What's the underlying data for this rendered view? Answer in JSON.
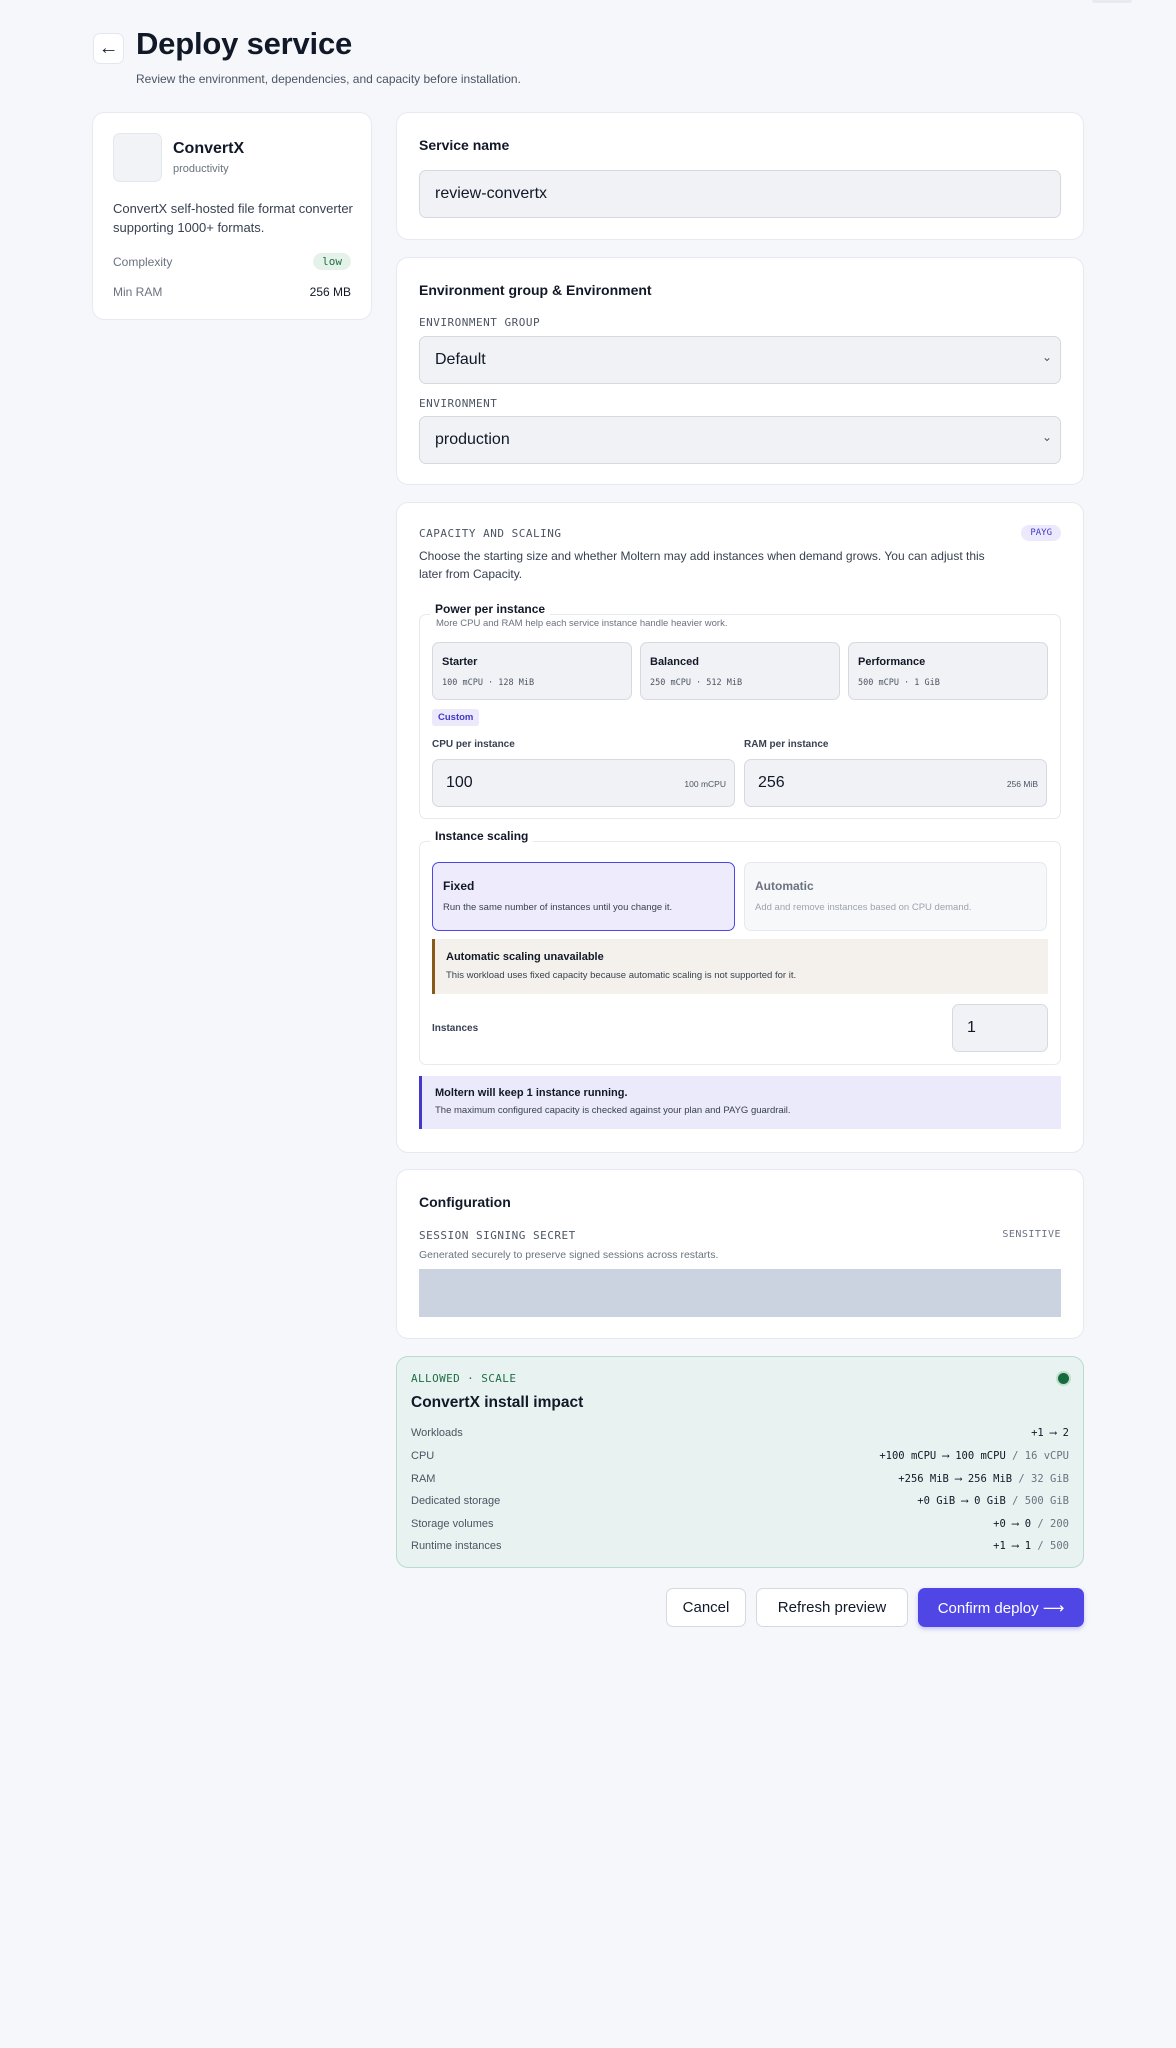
{
  "header": {
    "back_icon": "←",
    "title": "Deploy service",
    "subtitle": "Review the environment, dependencies, and capacity before installation."
  },
  "app": {
    "name": "ConvertX",
    "category": "productivity",
    "description": "ConvertX self-hosted file format converter supporting 1000+ formats.",
    "complexity_label": "Complexity",
    "complexity_value": "low",
    "min_ram_label": "Min RAM",
    "min_ram_value": "256 MB"
  },
  "service_name": {
    "title": "Service name",
    "value": "review-convertx"
  },
  "environment": {
    "title": "Environment group & Environment",
    "group_label": "ENVIRONMENT GROUP",
    "group_value": "Default",
    "env_label": "ENVIRONMENT",
    "env_value": "production",
    "chevron": "⌄"
  },
  "capacity": {
    "label": "CAPACITY AND SCALING",
    "badge": "PAYG",
    "description": "Choose the starting size and whether Moltern may add instances when demand grows. You can adjust this later from Capacity.",
    "power": {
      "legend": "Power per instance",
      "subtitle": "More CPU and RAM help each service instance handle heavier work.",
      "tiers": [
        {
          "name": "Starter",
          "spec": "100 mCPU · 128 MiB"
        },
        {
          "name": "Balanced",
          "spec": "250 mCPU · 512 MiB"
        },
        {
          "name": "Performance",
          "spec": "500 mCPU · 1 GiB"
        }
      ],
      "custom_tag": "Custom",
      "cpu_label": "CPU per instance",
      "cpu_value": "100",
      "cpu_unit": "100 mCPU",
      "ram_label": "RAM per instance",
      "ram_value": "256",
      "ram_unit": "256 MiB"
    },
    "scaling": {
      "legend": "Instance scaling",
      "fixed_title": "Fixed",
      "fixed_desc": "Run the same number of instances until you change it.",
      "auto_title": "Automatic",
      "auto_desc": "Add and remove instances based on CPU demand.",
      "warn_title": "Automatic scaling unavailable",
      "warn_desc": "This workload uses fixed capacity because automatic scaling is not supported for it.",
      "instances_label": "Instances",
      "instances_value": "1"
    },
    "info_title": "Moltern will keep 1 instance running.",
    "info_desc": "The maximum configured capacity is checked against your plan and PAYG guardrail."
  },
  "configuration": {
    "title": "Configuration",
    "secret_label": "SESSION SIGNING SECRET",
    "sensitive": "SENSITIVE",
    "secret_desc": "Generated securely to preserve signed sessions across restarts."
  },
  "impact": {
    "status": "ALLOWED · SCALE",
    "title": "ConvertX install impact",
    "status_color": "#156b3f",
    "rows": [
      {
        "label": "Workloads",
        "change": "+1 ⟶ 2",
        "limit": ""
      },
      {
        "label": "CPU",
        "change": "+100 mCPU ⟶ 100 mCPU",
        "limit": " / 16 vCPU"
      },
      {
        "label": "RAM",
        "change": "+256 MiB ⟶ 256 MiB",
        "limit": " / 32 GiB"
      },
      {
        "label": "Dedicated storage",
        "change": "+0 GiB ⟶ 0 GiB",
        "limit": " / 500 GiB"
      },
      {
        "label": "Storage volumes",
        "change": "+0 ⟶ 0",
        "limit": " / 200"
      },
      {
        "label": "Runtime instances",
        "change": "+1 ⟶ 1",
        "limit": " / 500"
      }
    ]
  },
  "actions": {
    "cancel": "Cancel",
    "refresh": "Refresh preview",
    "confirm": "Confirm deploy ⟶"
  },
  "colors": {
    "accent": "#4f46e5",
    "page_bg": "#f5f7fb",
    "success": "#1f6f43",
    "warning": "#8a5a1a"
  }
}
